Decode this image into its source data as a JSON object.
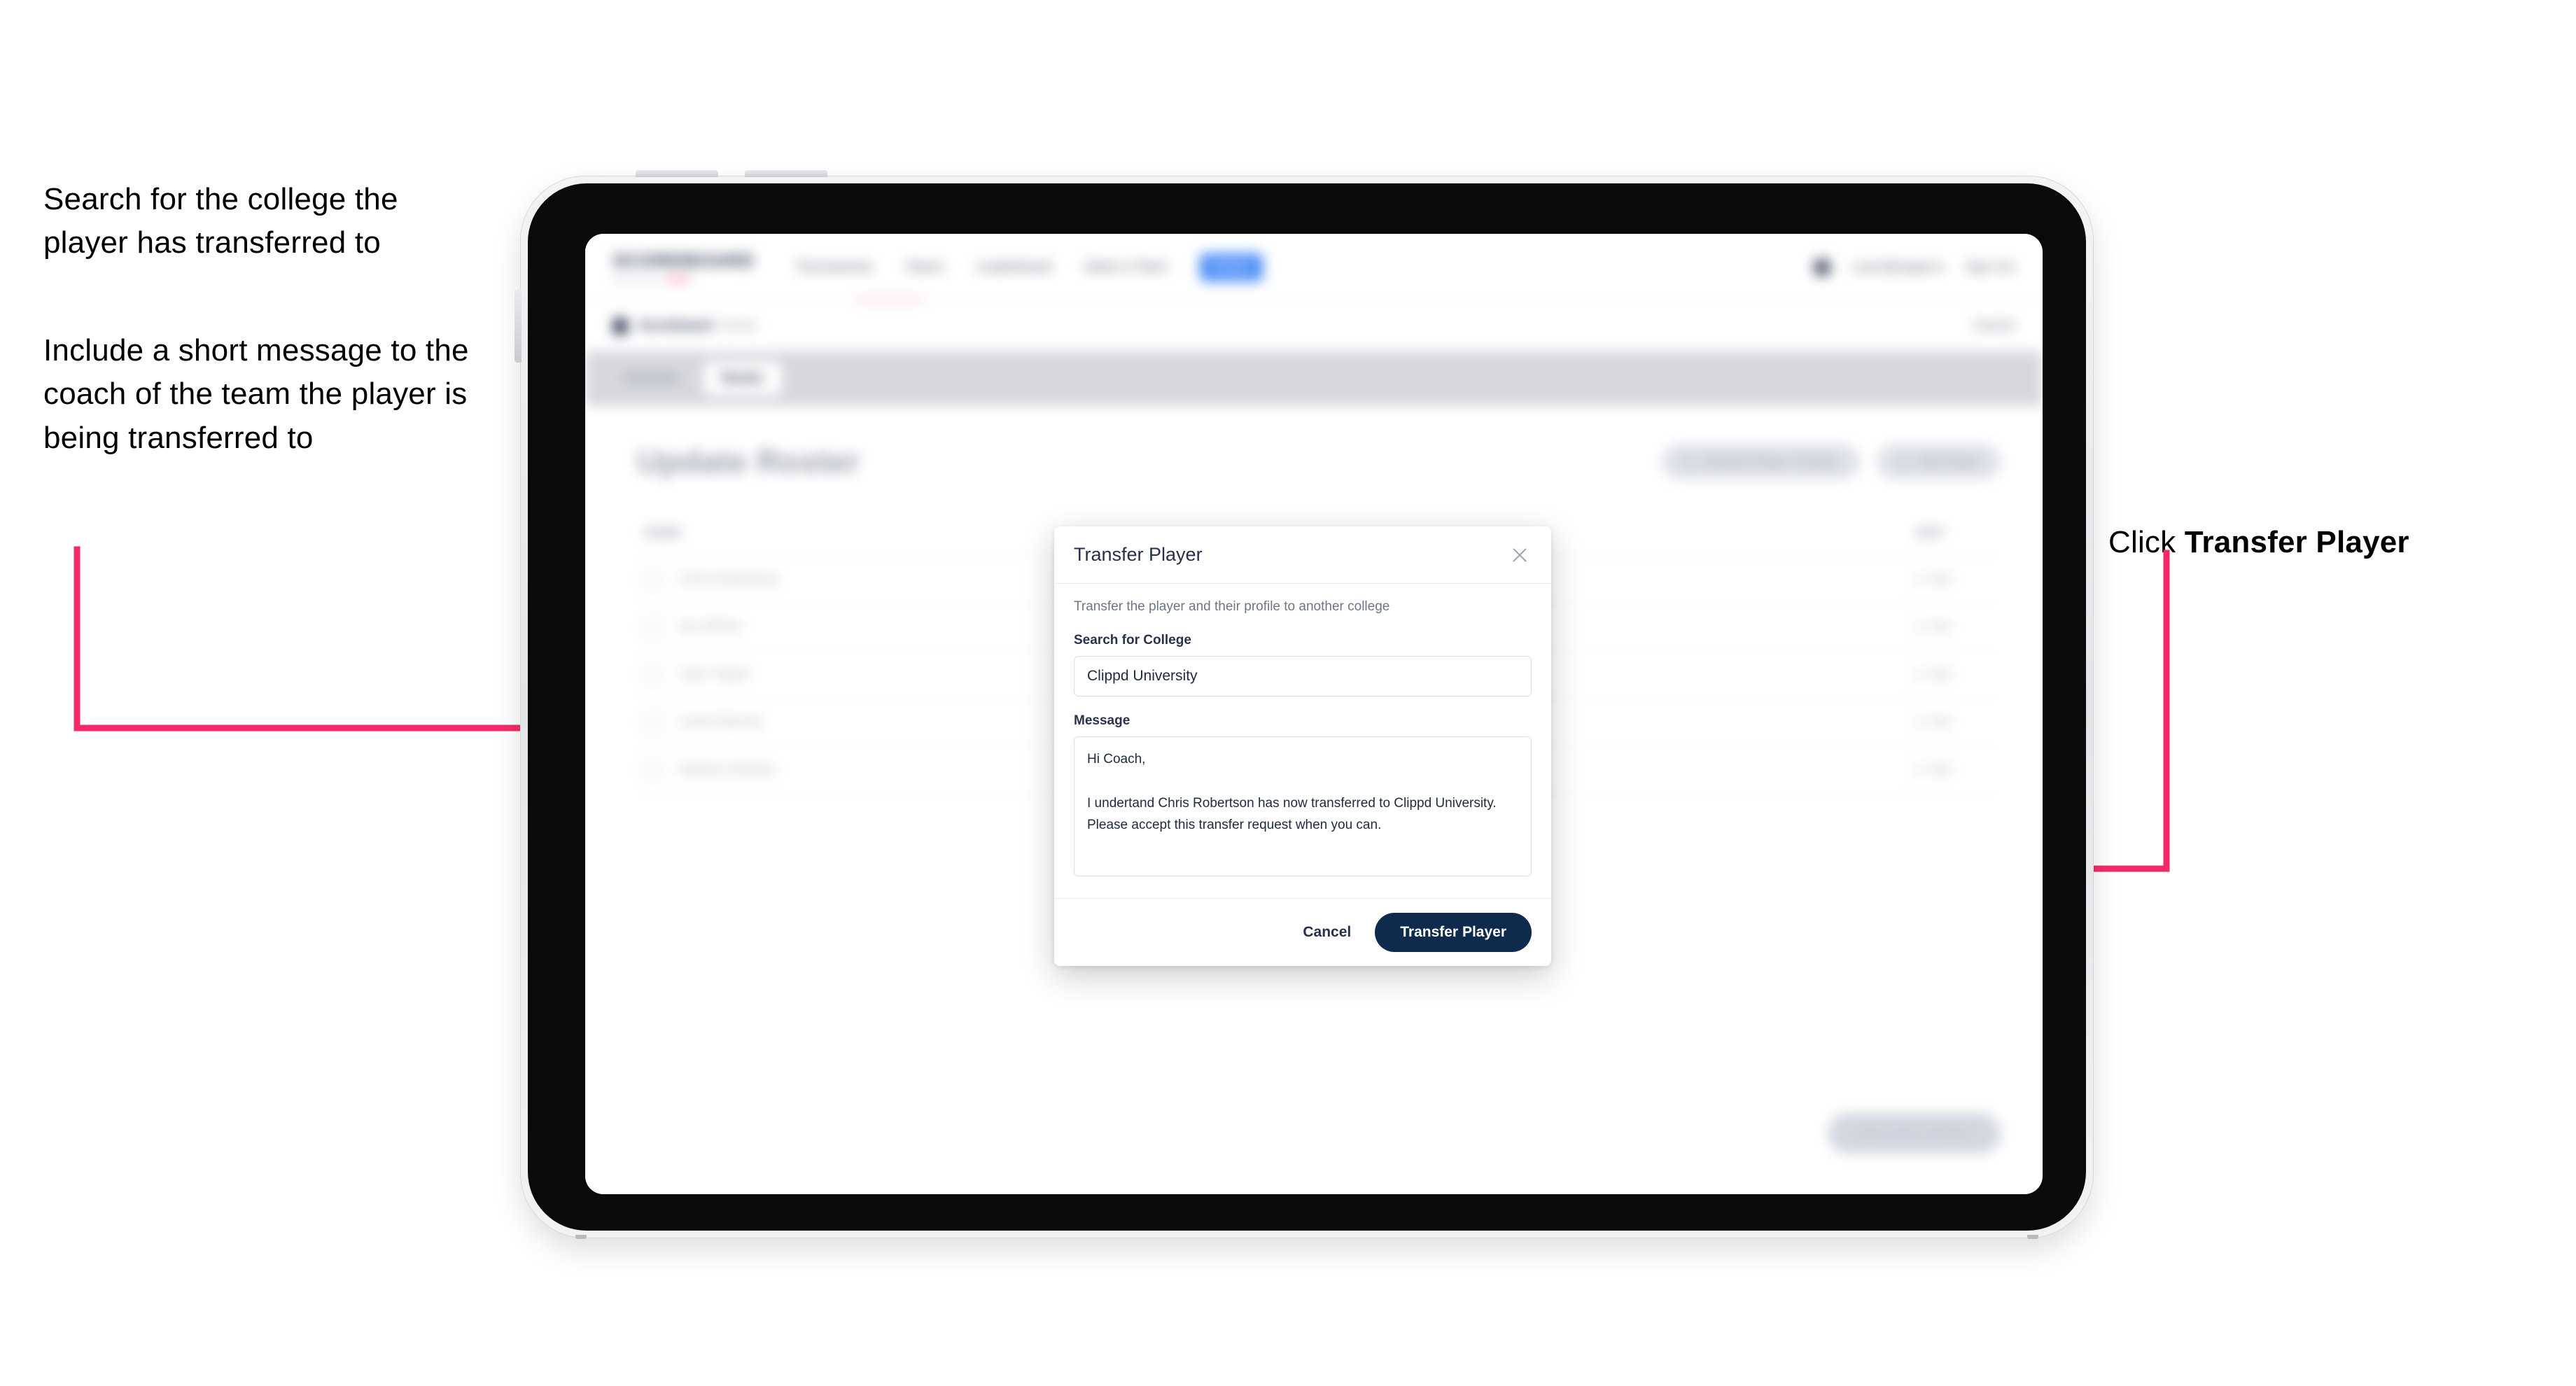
{
  "annotations": {
    "left_1": "Search for the college the player has transferred to",
    "left_2": "Include a short message to the coach of the team the player is being transferred to",
    "right_prefix": "Click ",
    "right_bold": "Transfer Player",
    "arrow_color": "#f42a68"
  },
  "app": {
    "brand": {
      "word": "SCOREBOARD",
      "sub": "powered by",
      "sub_accent": "clippd"
    },
    "nav": {
      "links": [
        "Tournaments",
        "Teams",
        "Leaderboard",
        "Select a Team"
      ],
      "pill": "Roster"
    },
    "nav_right": {
      "user": "coach@clippd.io",
      "signout": "Sign Out"
    },
    "breadcrumb": {
      "main": "Scoreboard",
      "sub": "Roster",
      "cancel": "Cancel"
    },
    "tabs": [
      {
        "label": "Overview",
        "active": false
      },
      {
        "label": "Roster",
        "active": true
      }
    ],
    "page_title": "Update Roster",
    "page_actions": [
      "Request Player Transfer",
      "Add Player"
    ],
    "roster": {
      "columns": {
        "name": "NAME",
        "action": "EDIT"
      },
      "rows": [
        {
          "name": "Chris Robertson",
          "action": "Edit"
        },
        {
          "name": "Ian Winter",
          "action": "Edit"
        },
        {
          "name": "John Taylor",
          "action": "Edit"
        },
        {
          "name": "Lewis Barnes",
          "action": "Edit"
        },
        {
          "name": "Nathan Holmes",
          "action": "Edit"
        }
      ]
    },
    "save_continue": "Save And Continue"
  },
  "modal": {
    "title": "Transfer Player",
    "description": "Transfer the player and their profile to another college",
    "college_label": "Search for College",
    "college_value": "Clippd University",
    "college_placeholder": "Search for College",
    "message_label": "Message",
    "message_value": "Hi Coach,\n\nI undertand Chris Robertson has now transferred to Clippd University. Please accept this transfer request when you can.",
    "message_placeholder": "Message",
    "cancel_label": "Cancel",
    "submit_label": "Transfer Player",
    "accent_color": "#0e2a4d"
  }
}
